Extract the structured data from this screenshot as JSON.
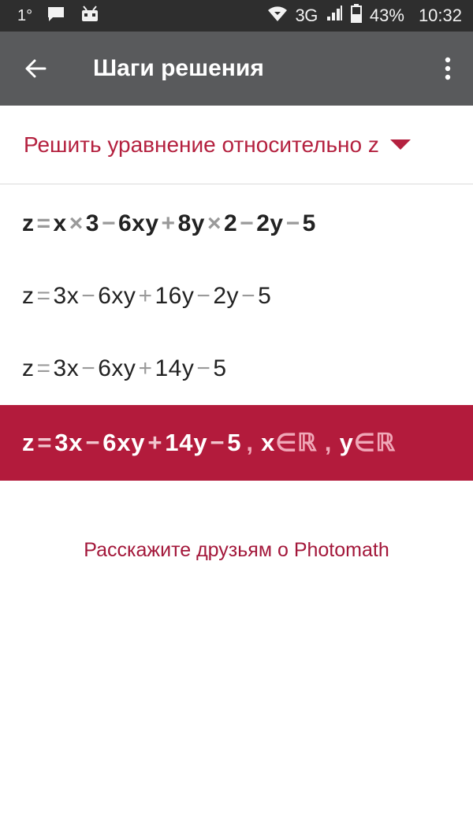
{
  "status_bar": {
    "temperature": "1°",
    "network": "3G",
    "battery": "43%",
    "time": "10:32"
  },
  "app_bar": {
    "title": "Шаги решения"
  },
  "method": {
    "label": "Решить уравнение относительно z"
  },
  "steps": [
    {
      "tokens": [
        "z",
        "=",
        "x",
        "×",
        "3",
        "−",
        "6xy",
        "+",
        "8y",
        "×",
        "2",
        "−",
        "2y",
        "−",
        "5"
      ]
    },
    {
      "tokens": [
        "z",
        "=",
        "3x",
        "−",
        "6xy",
        "+",
        "16y",
        "−",
        "2y",
        "−",
        "5"
      ]
    },
    {
      "tokens": [
        "z",
        "=",
        "3x",
        "−",
        "6xy",
        "+",
        "14y",
        "−",
        "5"
      ]
    }
  ],
  "result": {
    "tokens": [
      "z",
      "=",
      "3x",
      "−",
      "6xy",
      "+",
      "14y",
      "−",
      "5"
    ],
    "domain": {
      "sep1": ",",
      "x": "x",
      "in1": "∈ℝ",
      "sep2": ",",
      "y": "y",
      "in2": "∈ℝ"
    }
  },
  "share": {
    "label": "Расскажите друзьям о Photomath"
  },
  "colors": {
    "accent": "#b31b3c",
    "appbar": "#595a5c",
    "statusbar": "#2e2e2e"
  }
}
